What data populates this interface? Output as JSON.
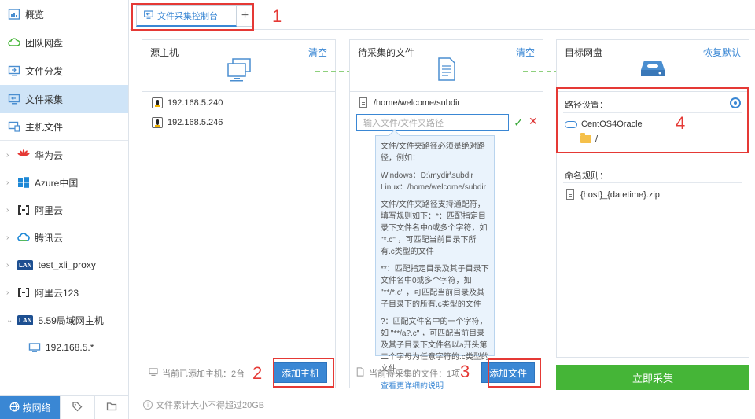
{
  "sidebar": {
    "items": [
      {
        "label": "概览"
      },
      {
        "label": "团队网盘"
      },
      {
        "label": "文件分发"
      },
      {
        "label": "文件采集"
      },
      {
        "label": "主机文件"
      }
    ],
    "clouds": [
      {
        "label": "华为云"
      },
      {
        "label": "Azure中国"
      },
      {
        "label": "阿里云"
      },
      {
        "label": "腾讯云"
      },
      {
        "label": "test_xli_proxy",
        "badge": "LAN"
      },
      {
        "label": "阿里云123"
      },
      {
        "label": "5.59局域网主机",
        "badge": "LAN"
      }
    ],
    "sub_host": "192.168.5.*",
    "bottom_tab": "按网络"
  },
  "tabs": {
    "active_label": "文件采集控制台",
    "add_symbol": "+"
  },
  "annotations": [
    "1",
    "2",
    "3",
    "4"
  ],
  "source_panel": {
    "title": "源主机",
    "action": "清空",
    "hosts": [
      "192.168.5.240",
      "192.168.5.246"
    ],
    "footer": "当前已添加主机：2台",
    "button": "添加主机"
  },
  "files_panel": {
    "title": "待采集的文件",
    "action": "清空",
    "file": "/home/welcome/subdir",
    "input_placeholder": "输入文件/文件夹路径",
    "help": [
      "文件/文件夹路径必须是绝对路径，例如：",
      "Windows：D:\\mydir\\subdir Linux：/home/welcome/subdir",
      "文件/文件夹路径支持通配符，填写规则如下：*：匹配指定目录下文件名中0或多个字符，如 \"*.c\" ，可匹配当前目录下所有.c类型的文件",
      "**：匹配指定目录及其子目录下文件名中0或多个字符，如 \"**/*.c\" ，可匹配当前目录及其子目录下的所有.c类型的文件",
      "?：匹配文件名中的一个字符，如 \"**/a?.c\" ，可匹配当前目录及其子目录下文件名以a开头第二个字母为任意字符的.c类型的文件"
    ],
    "help_link": "查看更详细的说明",
    "footer": "当前待采集的文件：1项",
    "button": "添加文件"
  },
  "target_panel": {
    "title": "目标网盘",
    "action": "恢复默认",
    "path_label": "路径设置：",
    "cloud_name": "CentOS4Oracle",
    "folder": "/",
    "naming_label": "命名规则：",
    "naming_rule": "{host}_{datetime}.zip"
  },
  "collect_button": "立即采集",
  "note": "文件累计大小不得超过20GB",
  "colors": {
    "accent": "#3a87d4",
    "active_bg": "#cfe4f7",
    "collect": "#45b537",
    "annotation": "#e53935"
  }
}
